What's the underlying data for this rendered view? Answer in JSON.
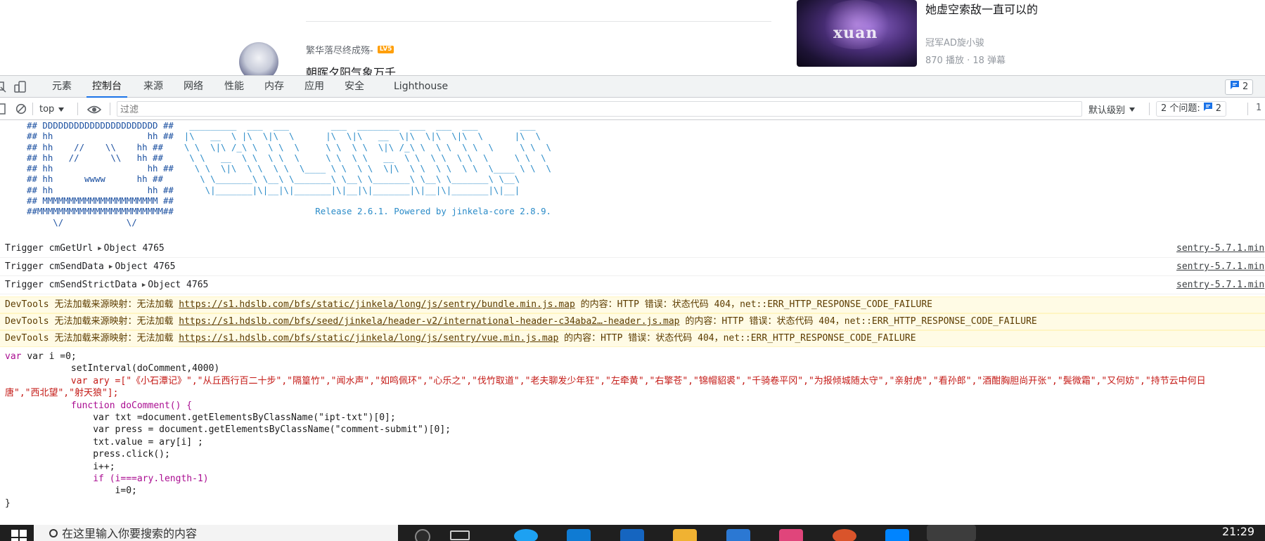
{
  "page": {
    "username": "繁华落尽终成殇-",
    "level_badge": "LV5",
    "comment_text": "朝晖夕阳气象万千",
    "video_title": "她虚空索敌一直可以的",
    "video_watermark": "xuan",
    "video_uploader": "冠军AD旋小骏",
    "video_stats": "870 播放 · 18 弹幕"
  },
  "devtools": {
    "tabs": [
      {
        "label": "元素",
        "active": false
      },
      {
        "label": "控制台",
        "active": true
      },
      {
        "label": "来源",
        "active": false
      },
      {
        "label": "网络",
        "active": false
      },
      {
        "label": "性能",
        "active": false
      },
      {
        "label": "内存",
        "active": false
      },
      {
        "label": "应用",
        "active": false
      },
      {
        "label": "安全",
        "active": false
      },
      {
        "label": "Lighthouse",
        "active": false
      }
    ],
    "issue_count": "2",
    "toolbar": {
      "context": "top",
      "filter_placeholder": "过滤",
      "log_level": "默认级别",
      "issues_label": "2 个问题:",
      "issues_count": "2",
      "right_counter": "1"
    }
  },
  "console": {
    "banner_lines": [
      "## DDDDDDDDDDDDDDDDDDDDDD ##",
      "## hh                  hh ##",
      "## hh    //    \\\\    hh ##",
      "## hh   //      \\\\   hh ##",
      "## hh                  hh ##",
      "## hh      wwww      hh ##",
      "## hh                  hh ##",
      "## MMMMMMMMMMMMMMMMMMMMMM ##",
      "##MMMMMMMMMMMMMMMMMMMMMMMM##",
      "     \\/            \\/"
    ],
    "release_text": "Release 2.6.1. Powered by jinkela-core 2.8.9.",
    "logs": [
      {
        "text": "Trigger cmGetUrl",
        "object": "Object 4765",
        "source": "sentry-5.7.1.min"
      },
      {
        "text": "Trigger cmSendData",
        "object": "Object 4765",
        "source": "sentry-5.7.1.min"
      },
      {
        "text": "Trigger cmSendStrictData",
        "object": "Object 4765",
        "source": "sentry-5.7.1.min"
      }
    ],
    "warnings": [
      {
        "prefix": "DevTools 无法加载来源映射：无法加载",
        "url": "https://s1.hdslb.com/bfs/static/jinkela/long/js/sentry/bundle.min.js.map",
        "suffix": "的内容：HTTP 错误：状态代码 404，net::ERR_HTTP_RESPONSE_CODE_FAILURE"
      },
      {
        "prefix": "DevTools 无法加载来源映射：无法加载",
        "url": "https://s1.hdslb.com/bfs/seed/jinkela/header-v2/international-header-c34aba2…-header.js.map",
        "suffix": "的内容：HTTP 错误：状态代码 404，net::ERR_HTTP_RESPONSE_CODE_FAILURE"
      },
      {
        "prefix": "DevTools 无法加载来源映射：无法加载",
        "url": "https://s1.hdslb.com/bfs/static/jinkela/long/js/sentry/vue.min.js.map",
        "suffix": "的内容：HTTP 错误：状态代码 404，net::ERR_HTTP_RESPONSE_CODE_FAILURE"
      }
    ],
    "code": {
      "line1": "var i =0;",
      "line2": "setInterval(doComment,4000)",
      "line3_head": "var ary =[",
      "ary_items": "\"《小石潭记》\",\"从丘西行百二十步\",\"隔篁竹\",\"闻水声\",\"如鸣佩环\",\"心乐之\",\"伐竹取道\",\"老夫聊发少年狂\",\"左牵黄\",\"右擎苍\",\"锦帽貂裘\",\"千骑卷平冈\",\"为报倾城随太守\",\"亲射虎\",\"看孙郎\",\"酒酣胸胆尚开张\",\"鬓微霜\",\"又何妨\",\"持节云中何日",
      "line4": "唐\",\"西北望\",\"射天狼\"];",
      "line5": "function doComment() {",
      "line6": "var txt =document.getElementsByClassName(\"ipt-txt\")[0];",
      "line7": "var press = document.getElementsByClassName(\"comment-submit\")[0];",
      "line8": "txt.value = ary[i] ;",
      "line9": "press.click();",
      "line10": "i++;",
      "line11": "if (i===ary.length-1)",
      "line12": "i=0;",
      "line13": "}"
    }
  },
  "taskbar": {
    "search_placeholder": "在这里输入你要搜索的内容",
    "clock": "21:29"
  }
}
